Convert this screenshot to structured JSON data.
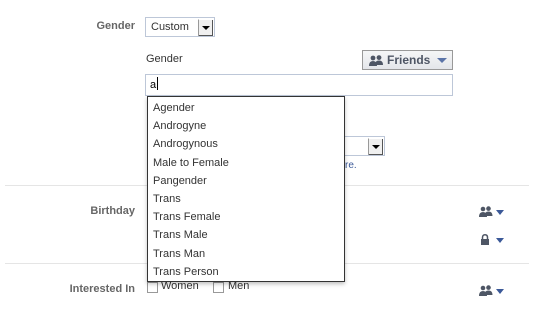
{
  "gender_section": {
    "label": "Gender",
    "select_value": "Custom",
    "sublabel": "Gender",
    "audience_label": "Friends",
    "input_value": "a"
  },
  "pronoun_select": {
    "value": ""
  },
  "partial_link": "re.",
  "suggestions": [
    "Agender",
    "Androgyne",
    "Androgynous",
    "Male to Female",
    "Pangender",
    "Trans",
    "Trans Female",
    "Trans Male",
    "Trans Man",
    "Trans Person"
  ],
  "birthday_section": {
    "label": "Birthday"
  },
  "interested_section": {
    "label": "Interested In",
    "options": [
      "Women",
      "Men"
    ]
  },
  "icons": [
    "friends-icon",
    "lock-icon",
    "caret-down-icon"
  ],
  "colors": {
    "link": "#3b5998",
    "label": "#666666",
    "border": "#bdc7d8"
  }
}
